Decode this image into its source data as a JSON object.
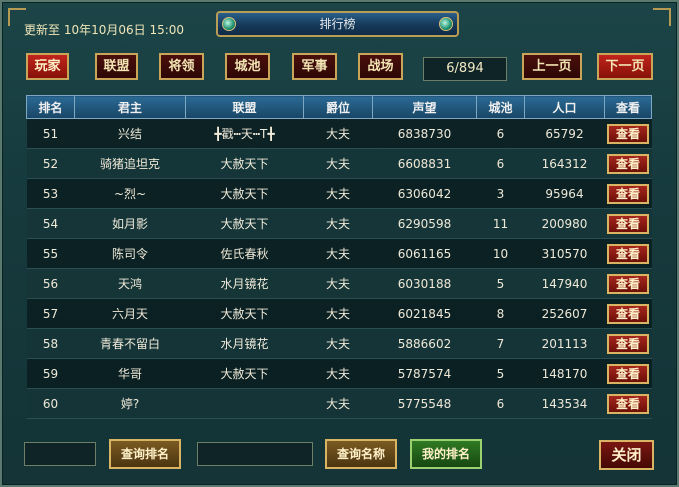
{
  "header": {
    "update_label": "更新至 10年10月06日 15:00",
    "title": "排行榜"
  },
  "tabs": [
    {
      "label": "玩家",
      "active": true
    },
    {
      "label": "联盟",
      "active": false
    },
    {
      "label": "将领",
      "active": false
    },
    {
      "label": "城池",
      "active": false
    },
    {
      "label": "军事",
      "active": false
    },
    {
      "label": "战场",
      "active": false
    }
  ],
  "pagination": {
    "indicator": "6/894",
    "prev_label": "上一页",
    "next_label": "下一页"
  },
  "table": {
    "columns": [
      "排名",
      "君主",
      "联盟",
      "爵位",
      "声望",
      "城池",
      "人口",
      "查看"
    ],
    "view_label": "查看",
    "rows": [
      {
        "rank": "51",
        "lord": "兴结",
        "alliance": "╋戳┅天┅T╋",
        "title": "大夫",
        "prestige": "6838730",
        "cities": "6",
        "population": "65792"
      },
      {
        "rank": "52",
        "lord": "骑猪追坦克",
        "alliance": "大赦天下",
        "title": "大夫",
        "prestige": "6608831",
        "cities": "6",
        "population": "164312"
      },
      {
        "rank": "53",
        "lord": "~烈~",
        "alliance": "大赦天下",
        "title": "大夫",
        "prestige": "6306042",
        "cities": "3",
        "population": "95964"
      },
      {
        "rank": "54",
        "lord": "如月影",
        "alliance": "大赦天下",
        "title": "大夫",
        "prestige": "6290598",
        "cities": "11",
        "population": "200980"
      },
      {
        "rank": "55",
        "lord": "陈司令",
        "alliance": "佐氏春秋",
        "title": "大夫",
        "prestige": "6061165",
        "cities": "10",
        "population": "310570"
      },
      {
        "rank": "56",
        "lord": "天鸿",
        "alliance": "水月镜花",
        "title": "大夫",
        "prestige": "6030188",
        "cities": "5",
        "population": "147940"
      },
      {
        "rank": "57",
        "lord": "六月天",
        "alliance": "大赦天下",
        "title": "大夫",
        "prestige": "6021845",
        "cities": "8",
        "population": "252607"
      },
      {
        "rank": "58",
        "lord": "青春不留白",
        "alliance": "水月镜花",
        "title": "大夫",
        "prestige": "5886602",
        "cities": "7",
        "population": "201113"
      },
      {
        "rank": "59",
        "lord": "华哥",
        "alliance": "大赦天下",
        "title": "大夫",
        "prestige": "5787574",
        "cities": "5",
        "population": "148170"
      },
      {
        "rank": "60",
        "lord": "婷?",
        "alliance": "",
        "title": "大夫",
        "prestige": "5775548",
        "cities": "6",
        "population": "143534"
      }
    ]
  },
  "footer": {
    "query_rank_label": "查询排名",
    "query_name_label": "查询名称",
    "my_rank_label": "我的排名",
    "close_label": "关闭"
  }
}
